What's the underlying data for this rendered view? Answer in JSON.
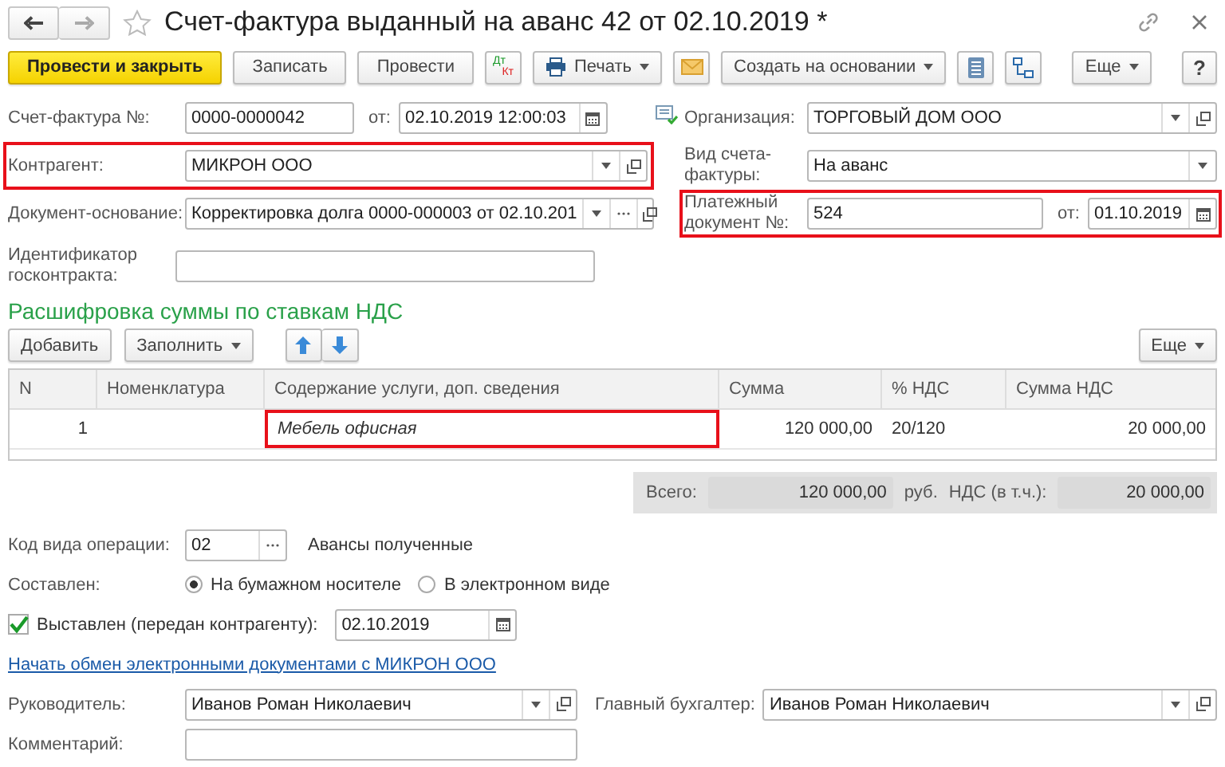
{
  "window": {
    "title": "Счет-фактура выданный на аванс 42 от 02.10.2019 *"
  },
  "toolbar": [
    {
      "kind": "primary",
      "label": "Провести и закрыть"
    },
    {
      "kind": "plain",
      "label": "Записать"
    },
    {
      "kind": "plain",
      "label": "Провести"
    },
    {
      "kind": "dtkt",
      "top": "Дт",
      "bottom": "Кт"
    },
    {
      "kind": "print",
      "label": "Печать"
    },
    {
      "kind": "mail"
    },
    {
      "kind": "menu",
      "label": "Создать на основании"
    },
    {
      "kind": "list"
    },
    {
      "kind": "structure"
    },
    {
      "kind": "menu",
      "label": "Еще"
    },
    {
      "kind": "help",
      "label": "?"
    }
  ],
  "header": {
    "invoice_number": {
      "label": "Счет-фактура №:",
      "value": "0000-0000042",
      "date_label": "от:",
      "date": "02.10.2019 12:00:03"
    },
    "counterparty": {
      "label": "Контрагент:",
      "value": "МИКРОН ООО",
      "highlighted": true
    },
    "base_document": {
      "label": "Документ-основание:",
      "value": "Корректировка долга 0000-000003 от 02.10.201"
    },
    "contract_id": {
      "label": "Идентификатор госконтракта:"
    },
    "organization": {
      "label": "Организация:",
      "value": "ТОРГОВЫЙ ДОМ ООО"
    },
    "invoice_type": {
      "label": "Вид счета-фактуры:",
      "value": "На аванс"
    },
    "payment_document": {
      "label": "Платежный документ №:",
      "number": "524",
      "date_label": "от:",
      "date": "01.10.2019",
      "highlighted": true
    }
  },
  "vat_breakdown": {
    "title": "Расшифровка суммы по ставкам НДС",
    "add_button": "Добавить",
    "fill_button": "Заполнить",
    "more_button": "Еще",
    "columns": [
      "N",
      "Номенклатура",
      "Содержание услуги, доп. сведения",
      "Сумма",
      "% НДС",
      "Сумма НДС"
    ],
    "rows": [
      {
        "n": "1",
        "description": "Мебель офисная",
        "description_highlighted": true,
        "amount": "120 000,00",
        "vat_rate": "20/120",
        "vat_amount": "20 000,00",
        "selected": false
      }
    ]
  },
  "totals": {
    "total_label": "Всего:",
    "total": "120 000,00",
    "currency": "руб.",
    "vat_label": "НДС (в т.ч.):",
    "vat": "20 000,00"
  },
  "operation_code": {
    "label": "Код вида операции:",
    "value": "02",
    "description": "Авансы полученные"
  },
  "composed": {
    "label": "Составлен:",
    "options": [
      {
        "label": "На бумажном носителе",
        "selected": true
      },
      {
        "label": "В электронном виде",
        "selected": false
      }
    ]
  },
  "issued": {
    "label": "Выставлен (передан контрагенту):",
    "checked": true,
    "date": "02.10.2019"
  },
  "edo_link": "Начать обмен электронными документами с МИКРОН ООО",
  "director": {
    "label": "Руководитель:",
    "value": "Иванов Роман Николаевич"
  },
  "chief_accountant": {
    "label": "Главный бухгалтер:",
    "value": "Иванов Роман Николаевич"
  },
  "comment": {
    "label": "Комментарий:"
  }
}
